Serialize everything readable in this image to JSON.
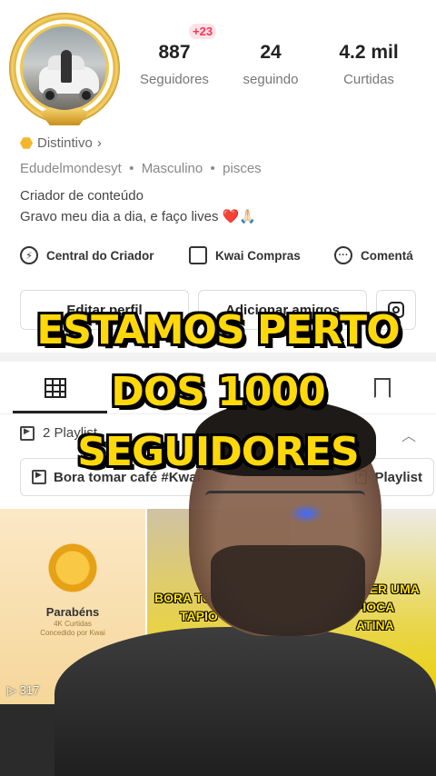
{
  "profile": {
    "new_followers_badge": "+23",
    "stats": [
      {
        "value": "887",
        "label": "Seguidores"
      },
      {
        "value": "24",
        "label": "seguindo"
      },
      {
        "value": "4.2 mil",
        "label": "Curtidas"
      }
    ],
    "distintivo_label": "Distintivo",
    "handle": "Edudelmondesyt",
    "gender": "Masculino",
    "sign": "pisces",
    "bio_line1": "Criador de conteúdo",
    "bio_line2": "Gravo meu dia a dia, e faço lives ❤️🙏🏻"
  },
  "quick_actions": [
    {
      "label": "Central do Criador",
      "icon": "bolt-icon"
    },
    {
      "label": "Kwai Compras",
      "icon": "shopping-bag-icon"
    },
    {
      "label": "Comentá",
      "icon": "comment-icon"
    }
  ],
  "buttons": {
    "edit_profile": "Editar perfil",
    "add_friends": "Adicionar amigos"
  },
  "playlists": {
    "count_label": "2 Playlist",
    "chips": [
      "Bora tomar café #Kwai",
      "Playlist"
    ]
  },
  "thumbnails": {
    "first": {
      "title": "Parabéns",
      "subtitle_line1": "4K Curtidas",
      "subtitle_line2": "Concedido por Kwai",
      "views": "317"
    },
    "second_caption": [
      "BORA TO",
      "TAPIO"
    ],
    "third_caption": [
      "AZER UMA",
      "PIOCA",
      "ATINA"
    ]
  },
  "overlay_caption": [
    "ESTAMOS PERTO",
    "DOS 1000",
    "SEGUIDORES"
  ]
}
